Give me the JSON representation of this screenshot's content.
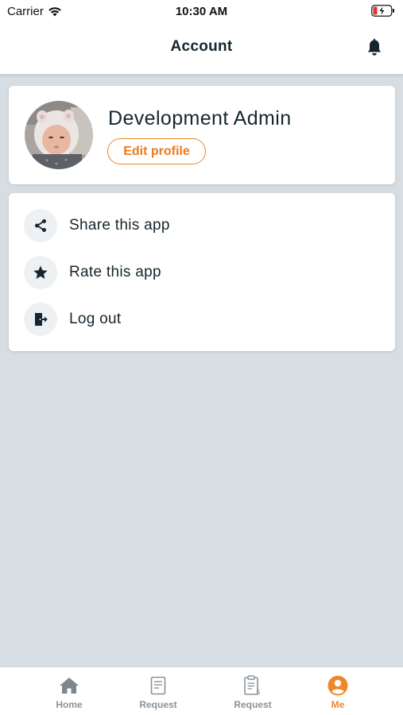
{
  "status_bar": {
    "carrier": "Carrier",
    "time": "10:30 AM",
    "wifi_icon": "wifi-icon",
    "battery_icon": "battery-charging-icon"
  },
  "header": {
    "title": "Account",
    "bell_icon": "bell-icon"
  },
  "profile": {
    "name": "Development Admin",
    "edit_label": "Edit profile",
    "avatar": "baby-photo-avatar"
  },
  "menu": {
    "items": [
      {
        "label": "Share this app",
        "icon": "share-icon"
      },
      {
        "label": "Rate this app",
        "icon": "star-icon"
      },
      {
        "label": "Log out",
        "icon": "logout-icon"
      }
    ]
  },
  "tabs": [
    {
      "label": "Home",
      "icon": "home-icon",
      "active": false
    },
    {
      "label": "Request",
      "icon": "document-icon",
      "active": false
    },
    {
      "label": "Request",
      "icon": "invoice-icon",
      "active": false
    },
    {
      "label": "Me",
      "icon": "user-icon",
      "active": true
    }
  ],
  "colors": {
    "accent": "#f0862a",
    "background": "#d6dde3",
    "text": "#16262e",
    "inactive_tab": "#8a939a"
  }
}
